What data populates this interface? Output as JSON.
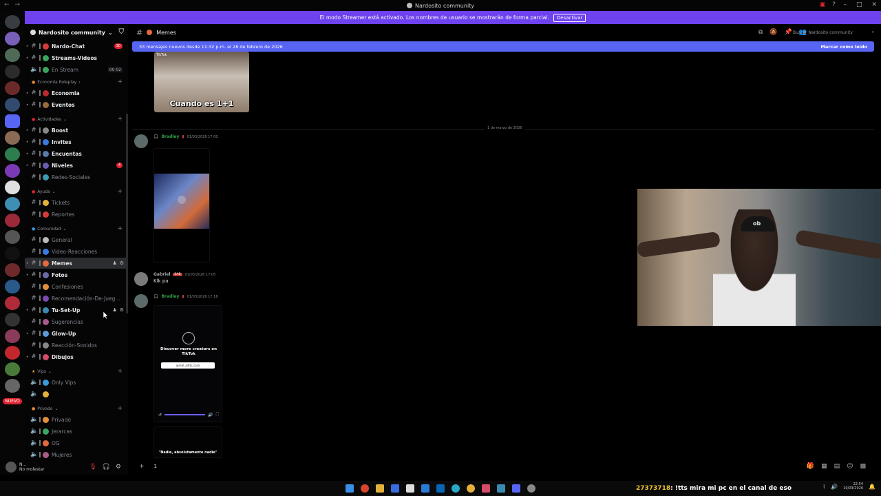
{
  "window": {
    "title": "Nardosito community"
  },
  "streamer_banner": {
    "text": "El modo Streamer está activado. Los nombres de usuario se mostrarán de forma parcial.",
    "button": "Desactivar"
  },
  "rail": {
    "badges": [
      "",
      "",
      "",
      "",
      "",
      "",
      "",
      "",
      "",
      "",
      "",
      "",
      "",
      "",
      "",
      "",
      "",
      "",
      "",
      "",
      "",
      "",
      "",
      ""
    ],
    "nuevo_label": "NUEVO"
  },
  "guild": {
    "name": "Nardosito community"
  },
  "sidebar": {
    "channels": [
      {
        "name": "Nardo-Chat",
        "type": "text",
        "count": "30"
      },
      {
        "name": "Streams-Videos",
        "type": "text"
      },
      {
        "name": "En Stream",
        "type": "voice",
        "voice_count": "00 02"
      }
    ],
    "categories": [
      {
        "name": "Economía Roleplay",
        "channels": [
          "Economia",
          "Eventos"
        ]
      },
      {
        "name": "Actividades",
        "channels": [
          "Boost",
          "Invites",
          "Encuentas",
          "Niveles",
          "Redes-Sociales"
        ],
        "niveles_count": "4"
      },
      {
        "name": "Ayuda",
        "channels": [
          "Tickets",
          "Reportes"
        ]
      },
      {
        "name": "Comunidad",
        "channels": [
          "General",
          "Video-Reacciones",
          "Memes",
          "Fotos",
          "Confesiones",
          "Recomendación-De-Jueg...",
          "Tu-Set-Up",
          "Sugerencias",
          "Glow-Up",
          "Reacción-Sonidos",
          "Dibujos"
        ]
      },
      {
        "name": "Vips",
        "channels": [
          "Only Vips",
          ""
        ]
      },
      {
        "name": "Privado",
        "channels": [
          "Privado",
          "Jerarcas",
          "OG",
          "Mujeres"
        ]
      }
    ]
  },
  "user": {
    "name": "N...",
    "status": "No molestar"
  },
  "channel": {
    "name": "Memes",
    "search_placeholder": "Buscar Nardosito community"
  },
  "new_messages": {
    "text": "33 mensajes nuevos desde 11:32 p.m. el 28 de febrero de 2026",
    "mark_read": "Marcar como leído"
  },
  "messages": {
    "thumb1_caption": "Cuando es 1+1",
    "thumb1_watermark": "TikTok",
    "date_divider": "1 de marzo de 2026",
    "m1": {
      "author": "Bradley",
      "time": "01/03/2026 17:00"
    },
    "m2": {
      "author": "Gabriel",
      "tag": "SAB",
      "time": "01/03/2026 17:05",
      "text": "Klk pa"
    },
    "m3": {
      "author": "Bradley",
      "time": "01/03/2026 17:16"
    },
    "tiktok_discover": "Discover more creators on TikTok",
    "tiktok_handle": "@real_adds_casa",
    "vid3_caption": "\"Nadie, absolutamente nadie\""
  },
  "composer": {
    "text": "1"
  },
  "taskbar": {
    "ticker_id": "27373718",
    "ticker_text": ": !tts mira mi pc en el canal de eso",
    "time": "22:54",
    "date": "10/03/2026"
  },
  "colors": {
    "banner": "#6e42ef",
    "new_msg_bar": "#5865f2",
    "author_green": "#2fa34a",
    "badge_red": "#e0242f"
  }
}
